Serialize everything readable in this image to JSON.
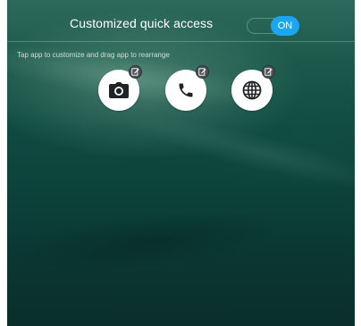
{
  "header": {
    "title": "Customized quick access",
    "toggle_label": "ON"
  },
  "hint_text": "Tap app to customize and drag app to rearrange",
  "apps": [
    {
      "icon": "camera-icon"
    },
    {
      "icon": "phone-icon"
    },
    {
      "icon": "globe-icon"
    }
  ],
  "colors": {
    "toggle_accent": "#1aa6f0",
    "badge": "#4a5056"
  }
}
